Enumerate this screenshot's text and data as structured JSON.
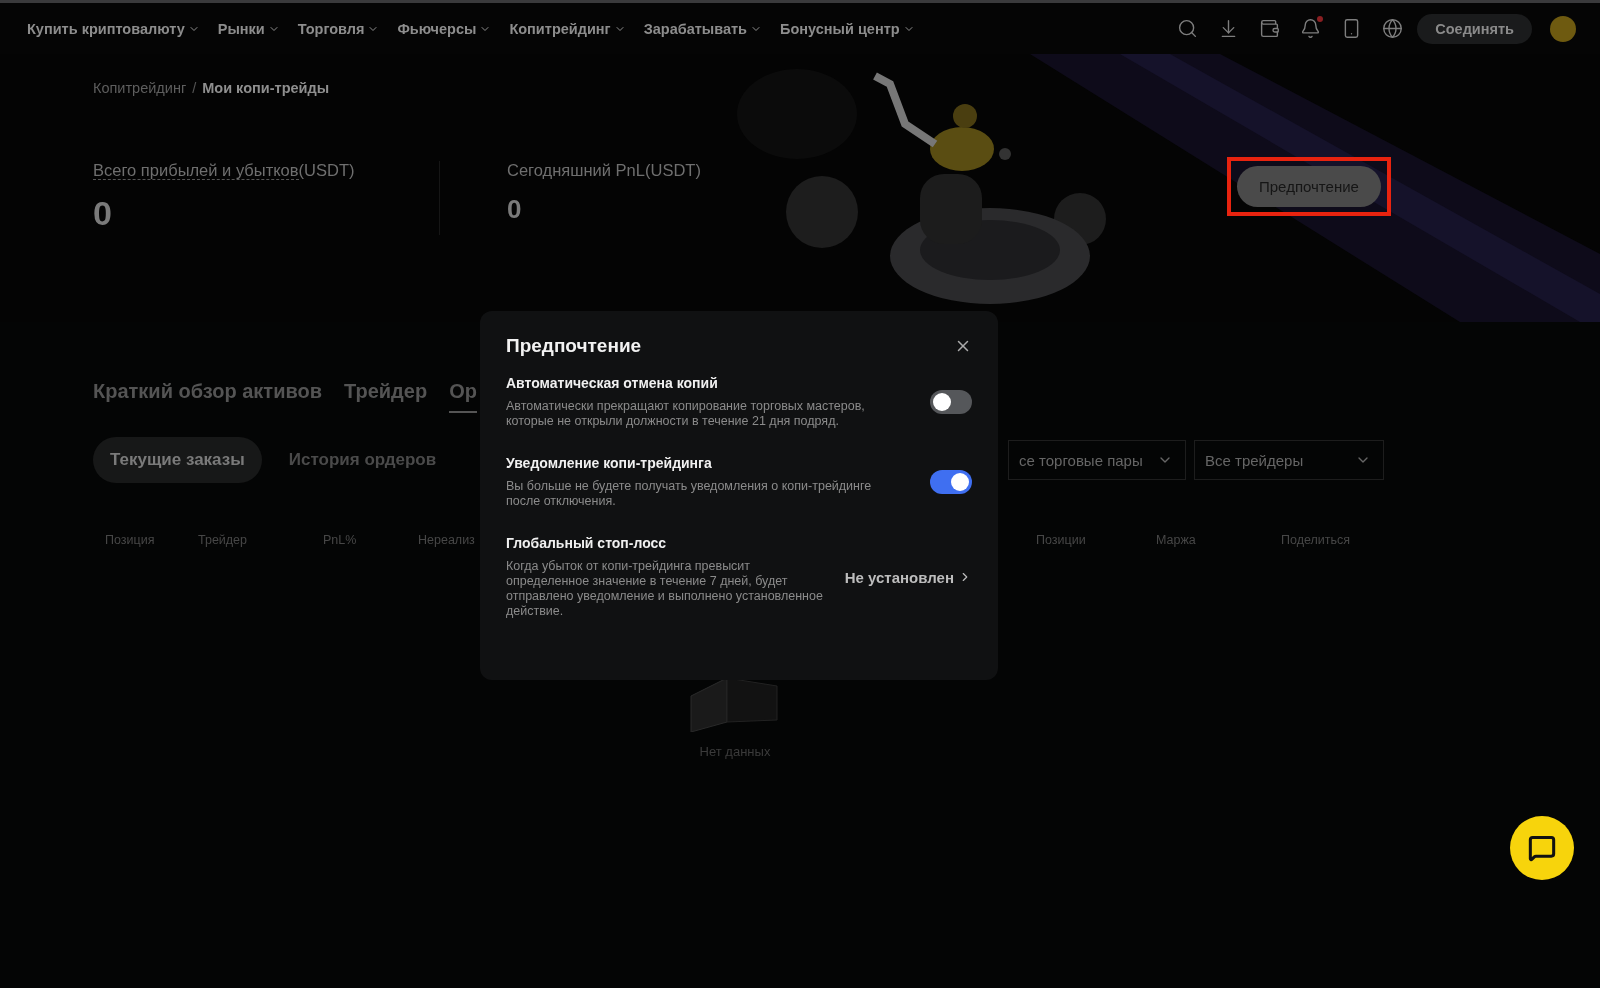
{
  "nav": {
    "items": [
      {
        "label": "Купить криптовалюту",
        "has_caret": true
      },
      {
        "label": "Рынки",
        "has_caret": true
      },
      {
        "label": "Торговля",
        "has_caret": true
      },
      {
        "label": "Фьючерсы",
        "has_caret": true
      },
      {
        "label": "Копитрейдинг",
        "has_caret": true
      },
      {
        "label": "Зарабатывать",
        "has_caret": true
      },
      {
        "label": "Бонусный центр",
        "has_caret": true
      }
    ],
    "notifications_unread": true,
    "connect_button": "Соединять"
  },
  "breadcrumb_separator": "/",
  "breadcrumb": [
    {
      "label": "Копитрейдинг",
      "selected": false
    },
    {
      "label": "Мои копи-трейды",
      "selected": true
    }
  ],
  "stats": [
    {
      "kind": "total",
      "label": "Всего прибылей и убытков",
      "unit": "(USDT)",
      "underlined": true,
      "value": "0"
    },
    {
      "kind": "daily",
      "label": "Сегодняшний PnL",
      "unit": "(USDT)",
      "underlined": false,
      "value": "0"
    }
  ],
  "preference_button": {
    "label": "Предпочтение",
    "highlighted": true
  },
  "tabs": [
    {
      "label": "Краткий обзор активов",
      "selected": false
    },
    {
      "label": "Трейдер",
      "selected": false
    },
    {
      "label": "Ор",
      "selected": true
    }
  ],
  "subtabs": [
    {
      "label": "Текущие заказы",
      "selected": true
    },
    {
      "label": "История ордеров",
      "selected": false
    }
  ],
  "filters": [
    {
      "value": "се торговые пары"
    },
    {
      "value": "Все трейдеры"
    }
  ],
  "table": {
    "columns_left": [
      "Позиция",
      "Трейдер",
      "PnL%",
      "Нереализ"
    ],
    "columns_right": [
      "Позиции",
      "Маржа",
      "Поделиться"
    ],
    "empty_text": "Нет данных"
  },
  "dialog": {
    "title": "Предпочтение",
    "items": [
      {
        "kind": "toggle",
        "title": "Автоматическая отмена копий",
        "description": "Автоматически прекращают копирование торговых мастеров, которые не открыли должности в течение 21 дня подряд.",
        "on": false
      },
      {
        "kind": "toggle",
        "title": "Уведомление копи-трейдинга",
        "description": "Вы больше не будете получать уведомления о копи-трейдинге после отключения.",
        "on": true
      },
      {
        "kind": "link",
        "title": "Глобальный стоп-лосс",
        "description": "Когда убыток от копи-трейдинга превысит определенное значение в течение 7 дней, будет отправлено уведомление и выполнено установленное действие.",
        "value": "Не установлен"
      }
    ]
  }
}
